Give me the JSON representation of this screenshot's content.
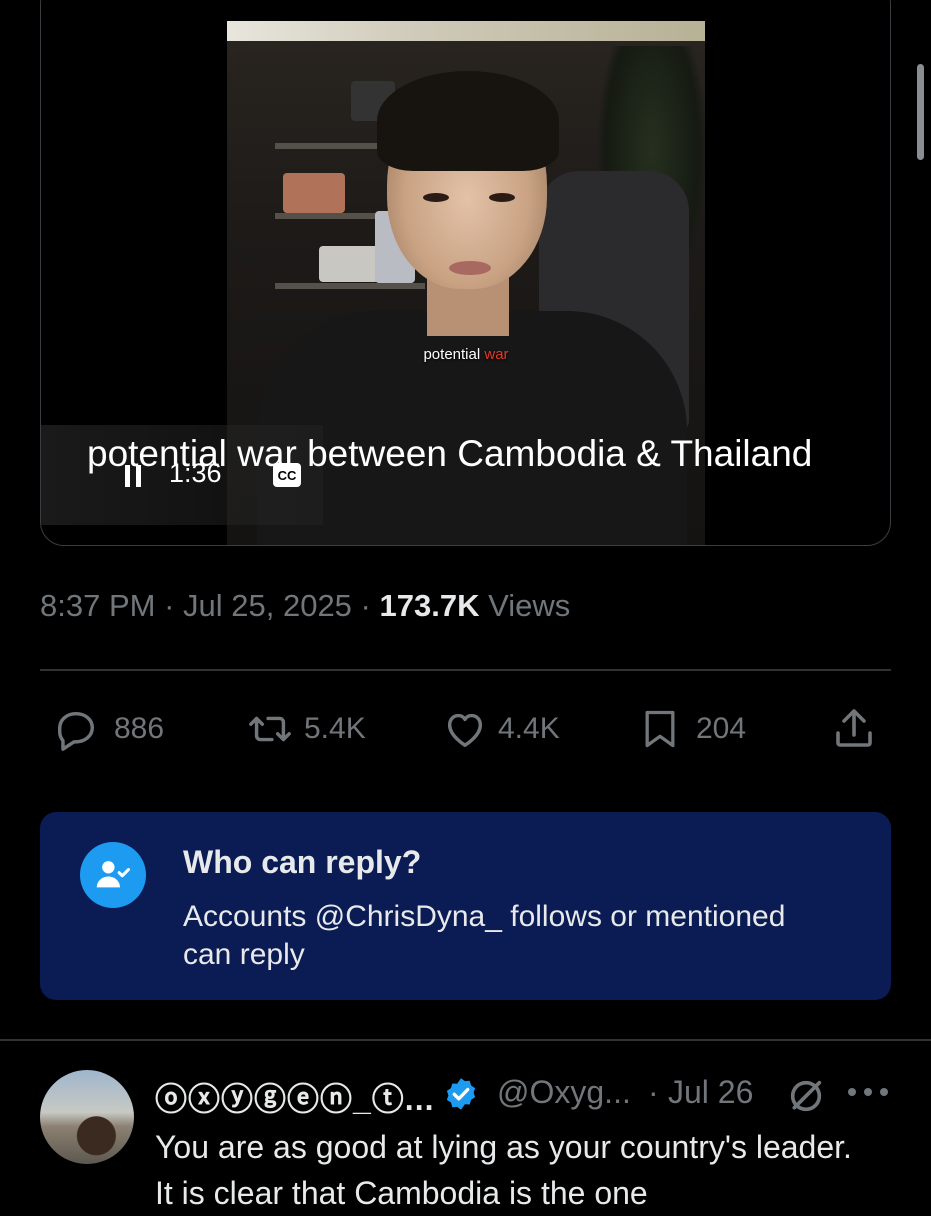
{
  "media": {
    "card_title": "potential war between Cambodia & Thailand",
    "video_caption_pre": "potential",
    "video_caption_hl": "war",
    "time": "1:36",
    "cc_label": "CC"
  },
  "meta": {
    "time": "8:37 PM",
    "sep1": " · ",
    "date": "Jul 25, 2025",
    "sep2": " · ",
    "views_count": "173.7K",
    "views_label": " Views"
  },
  "actions": {
    "replies": "886",
    "reposts": "5.4K",
    "likes": "4.4K",
    "bookmarks": "204"
  },
  "who_can_reply": {
    "title": "Who can reply?",
    "text": "Accounts @ChrisDyna_ follows or mentioned can reply"
  },
  "comment": {
    "display_name": "ⓞⓧⓨⓖⓔⓝ_ⓣ...",
    "handle": "@Oxyg...",
    "dot": "·",
    "date": "Jul 26",
    "text": "You are as good at lying as your country's leader. It is clear that Cambodia is the one"
  },
  "colors": {
    "background": "#000000",
    "muted": "#71767b",
    "reply_card": "#0b1b54",
    "accent": "#1d9bf0"
  },
  "icons": [
    "pause-icon",
    "cc-icon",
    "reply-icon",
    "repost-icon",
    "like-icon",
    "bookmark-icon",
    "share-icon",
    "add-user-icon",
    "verified-icon",
    "no-sign-icon",
    "more-icon"
  ]
}
